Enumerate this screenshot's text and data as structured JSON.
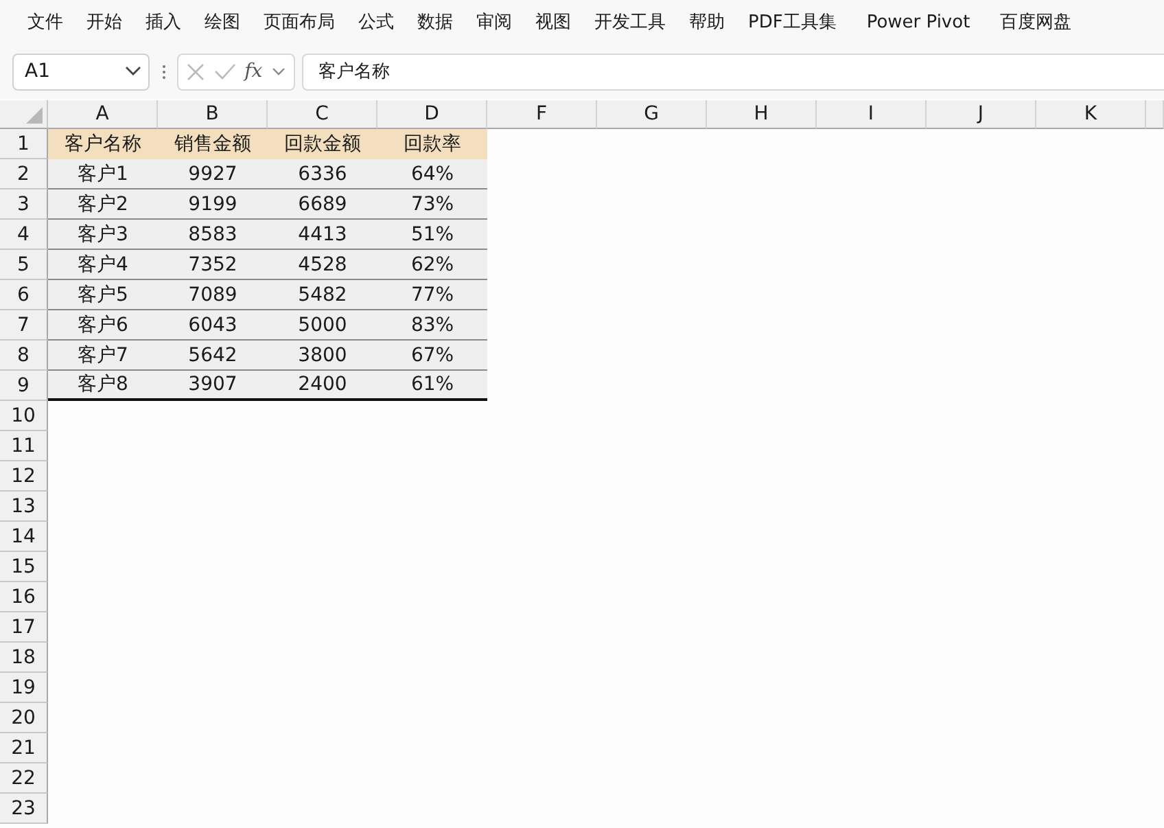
{
  "menu": [
    "文件",
    "开始",
    "插入",
    "绘图",
    "页面布局",
    "公式",
    "数据",
    "审阅",
    "视图",
    "开发工具",
    "帮助",
    "PDF工具集",
    "Power Pivot",
    "百度网盘"
  ],
  "formula_bar": {
    "name_box": "A1",
    "fx_label": "fx",
    "value": "客户名称"
  },
  "columns": [
    "A",
    "B",
    "C",
    "D",
    "F",
    "G",
    "H",
    "I",
    "J",
    "K"
  ],
  "table": {
    "header": [
      "客户名称",
      "销售金额",
      "回款金额",
      "回款率"
    ],
    "rows": [
      [
        "客户1",
        "9927",
        "6336",
        "64%"
      ],
      [
        "客户2",
        "9199",
        "6689",
        "73%"
      ],
      [
        "客户3",
        "8583",
        "4413",
        "51%"
      ],
      [
        "客户4",
        "7352",
        "4528",
        "62%"
      ],
      [
        "客户5",
        "7089",
        "5482",
        "77%"
      ],
      [
        "客户6",
        "6043",
        "5000",
        "83%"
      ],
      [
        "客户7",
        "5642",
        "3800",
        "67%"
      ],
      [
        "客户8",
        "3907",
        "2400",
        "61%"
      ]
    ]
  },
  "row_numbers": [
    "1",
    "2",
    "3",
    "4",
    "5",
    "6",
    "7",
    "8",
    "9",
    "10",
    "11",
    "12",
    "13",
    "14",
    "15",
    "16",
    "17",
    "18",
    "19",
    "20",
    "21",
    "22",
    "23"
  ]
}
